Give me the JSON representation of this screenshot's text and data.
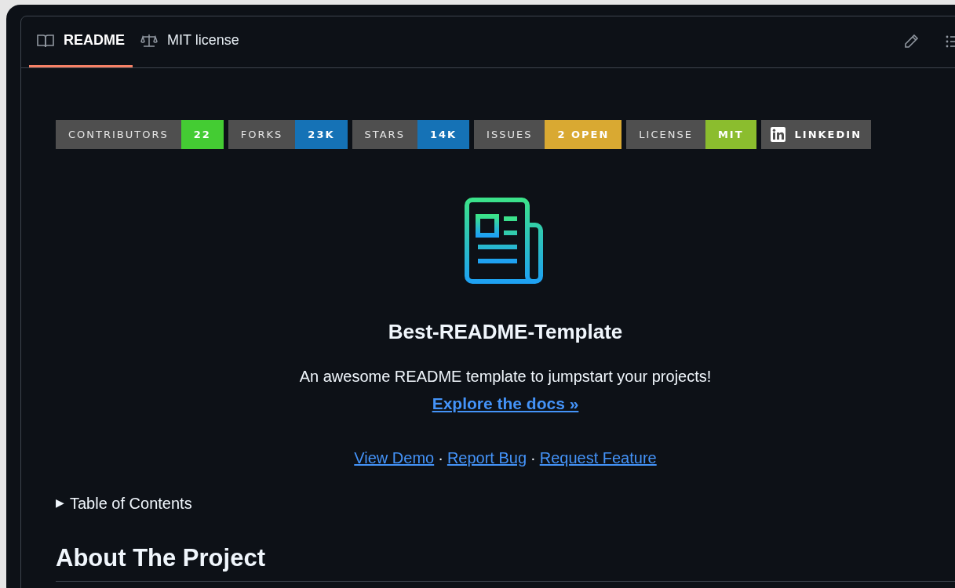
{
  "tabs": [
    {
      "label": "README",
      "selected": true
    },
    {
      "label": "MIT license",
      "selected": false
    }
  ],
  "badges": [
    {
      "kind": "pair",
      "label": "CONTRIBUTORS",
      "value": "22",
      "color": "#44cc33"
    },
    {
      "kind": "pair",
      "label": "FORKS",
      "value": "23K",
      "color": "#1572b6"
    },
    {
      "kind": "pair",
      "label": "STARS",
      "value": "14K",
      "color": "#1572b6"
    },
    {
      "kind": "pair",
      "label": "ISSUES",
      "value": "2 OPEN",
      "color": "#d9a932"
    },
    {
      "kind": "pair",
      "label": "LICENSE",
      "value": "MIT",
      "color": "#8bbd2e"
    },
    {
      "kind": "logo",
      "value": "LINKEDIN"
    }
  ],
  "title": "Best-README-Template",
  "tagline": "An awesome README template to jumpstart your projects!",
  "docs_link": "Explore the docs »",
  "links": [
    "View Demo",
    "Report Bug",
    "Request Feature"
  ],
  "separator": "·",
  "toc": {
    "marker": "▶",
    "label": "Table of Contents",
    "expanded": false
  },
  "heading": "About The Project"
}
